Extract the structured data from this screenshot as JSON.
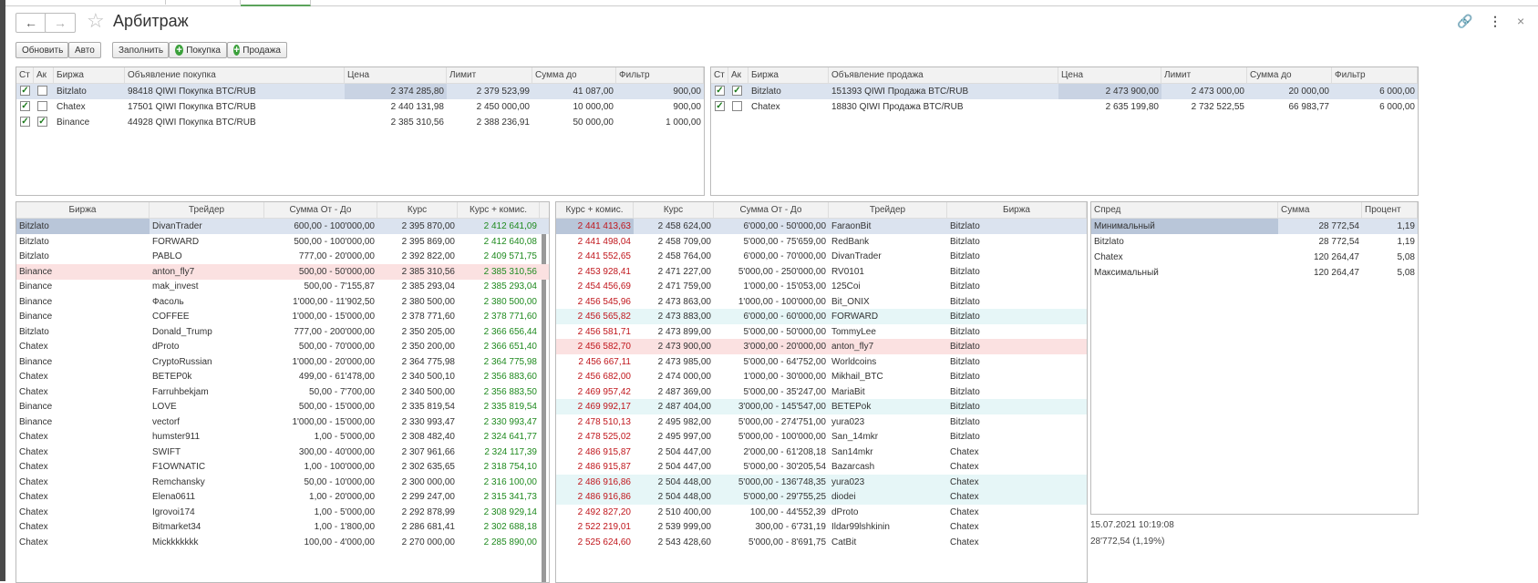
{
  "window": {
    "title": "Арбитраж"
  },
  "toolbar": {
    "refresh": "Обновить",
    "auto": "Авто",
    "fill": "Заполнить",
    "buy": "Покупка",
    "sell": "Продажа"
  },
  "buy_ads": {
    "columns": [
      "Ст",
      "Ак",
      "Биржа",
      "Объявление покупка",
      "Цена",
      "Лимит",
      "Сумма до",
      "Фильтр"
    ],
    "rows": [
      {
        "st": true,
        "ak": false,
        "exchange": "Bitzlato",
        "ad": "98418 QIWI Покупка BTC/RUB",
        "price": "2 374 285,80",
        "limit": "2 379 523,99",
        "sum_to": "41 087,00",
        "filter": "900,00"
      },
      {
        "st": true,
        "ak": false,
        "exchange": "Chatex",
        "ad": "17501 QIWI Покупка BTC/RUB",
        "price": "2 440 131,98",
        "limit": "2 450 000,00",
        "sum_to": "10 000,00",
        "filter": "900,00"
      },
      {
        "st": true,
        "ak": true,
        "exchange": "Binance",
        "ad": "44928 QIWI Покупка BTC/RUB",
        "price": "2 385 310,56",
        "limit": "2 388 236,91",
        "sum_to": "50 000,00",
        "filter": "1 000,00"
      }
    ]
  },
  "sell_ads": {
    "columns": [
      "Ст",
      "Ак",
      "Биржа",
      "Объявление продажа",
      "Цена",
      "Лимит",
      "Сумма до",
      "Фильтр"
    ],
    "rows": [
      {
        "st": true,
        "ak": true,
        "exchange": "Bitzlato",
        "ad": "151393 QIWI Продажа BTC/RUB",
        "price": "2 473 900,00",
        "limit": "2 473 000,00",
        "sum_to": "20 000,00",
        "filter": "6 000,00"
      },
      {
        "st": true,
        "ak": false,
        "exchange": "Chatex",
        "ad": "18830 QIWI Продажа BTC/RUB",
        "price": "2 635 199,80",
        "limit": "2 732 522,55",
        "sum_to": "66 983,77",
        "filter": "6 000,00"
      }
    ]
  },
  "buy_offers": {
    "columns": [
      "Биржа",
      "Трейдер",
      "Сумма От - До",
      "Курс",
      "Курс + комис."
    ],
    "rows": [
      [
        "Bitzlato",
        "DivanTrader",
        "600,00 - 100'000,00",
        "2 395 870,00",
        "2 412 641,09"
      ],
      [
        "Bitzlato",
        "FORWARD",
        "500,00 - 100'000,00",
        "2 395 869,00",
        "2 412 640,08"
      ],
      [
        "Bitzlato",
        "PABLO",
        "777,00 - 20'000,00",
        "2 392 822,00",
        "2 409 571,75"
      ],
      [
        "Binance",
        "anton_fly7",
        "500,00 - 50'000,00",
        "2 385 310,56",
        "2 385 310,56"
      ],
      [
        "Binance",
        "mak_invest",
        "500,00 - 7'155,87",
        "2 385 293,04",
        "2 385 293,04"
      ],
      [
        "Binance",
        "Фасоль",
        "1'000,00 - 11'902,50",
        "2 380 500,00",
        "2 380 500,00"
      ],
      [
        "Binance",
        "COFFEE",
        "1'000,00 - 15'000,00",
        "2 378 771,60",
        "2 378 771,60"
      ],
      [
        "Bitzlato",
        "Donald_Trump",
        "777,00 - 200'000,00",
        "2 350 205,00",
        "2 366 656,44"
      ],
      [
        "Chatex",
        "dProto",
        "500,00 - 70'000,00",
        "2 350 200,00",
        "2 366 651,40"
      ],
      [
        "Binance",
        "CryptoRussian",
        "1'000,00 - 20'000,00",
        "2 364 775,98",
        "2 364 775,98"
      ],
      [
        "Chatex",
        "ВЕТЕР0k",
        "499,00 - 61'478,00",
        "2 340 500,10",
        "2 356 883,60"
      ],
      [
        "Chatex",
        "Farruhbekjam",
        "50,00 - 7'700,00",
        "2 340 500,00",
        "2 356 883,50"
      ],
      [
        "Binance",
        "LOVE",
        "500,00 - 15'000,00",
        "2 335 819,54",
        "2 335 819,54"
      ],
      [
        "Binance",
        "vectorf",
        "1'000,00 - 15'000,00",
        "2 330 993,47",
        "2 330 993,47"
      ],
      [
        "Chatex",
        "humster911",
        "1,00 - 5'000,00",
        "2 308 482,40",
        "2 324 641,77"
      ],
      [
        "Chatex",
        "SWIFT",
        "300,00 - 40'000,00",
        "2 307 961,66",
        "2 324 117,39"
      ],
      [
        "Chatex",
        "F1OWNATIC",
        "1,00 - 100'000,00",
        "2 302 635,65",
        "2 318 754,10"
      ],
      [
        "Chatex",
        "Remchansky",
        "50,00 - 10'000,00",
        "2 300 000,00",
        "2 316 100,00"
      ],
      [
        "Chatex",
        "Elena0611",
        "1,00 - 20'000,00",
        "2 299 247,00",
        "2 315 341,73"
      ],
      [
        "Chatex",
        "Igrovoi174",
        "1,00 - 5'000,00",
        "2 292 878,99",
        "2 308 929,14"
      ],
      [
        "Chatex",
        "Bitmarket34",
        "1,00 - 1'800,00",
        "2 286 681,41",
        "2 302 688,18"
      ],
      [
        "Chatex",
        "Mickkkkkkk",
        "100,00 - 4'000,00",
        "2 270 000,00",
        "2 285 890,00"
      ]
    ]
  },
  "sell_offers": {
    "columns": [
      "Курс + комис.",
      "Курс",
      "Сумма От - До",
      "Трейдер",
      "Биржа"
    ],
    "rows": [
      [
        "2 441 413,63",
        "2 458 624,00",
        "6'000,00 - 50'000,00",
        "FaraonBit",
        "Bitzlato"
      ],
      [
        "2 441 498,04",
        "2 458 709,00",
        "5'000,00 - 75'659,00",
        "RedBank",
        "Bitzlato"
      ],
      [
        "2 441 552,65",
        "2 458 764,00",
        "6'000,00 - 70'000,00",
        "DivanTrader",
        "Bitzlato"
      ],
      [
        "2 453 928,41",
        "2 471 227,00",
        "5'000,00 - 250'000,00",
        "RV0101",
        "Bitzlato"
      ],
      [
        "2 454 456,69",
        "2 471 759,00",
        "1'000,00 - 15'053,00",
        "125Coi",
        "Bitzlato"
      ],
      [
        "2 456 545,96",
        "2 473 863,00",
        "1'000,00 - 100'000,00",
        "Bit_ONIX",
        "Bitzlato"
      ],
      [
        "2 456 565,82",
        "2 473 883,00",
        "6'000,00 - 60'000,00",
        "FORWARD",
        "Bitzlato"
      ],
      [
        "2 456 581,71",
        "2 473 899,00",
        "5'000,00 - 50'000,00",
        "TommyLee",
        "Bitzlato"
      ],
      [
        "2 456 582,70",
        "2 473 900,00",
        "3'000,00 - 20'000,00",
        "anton_fly7",
        "Bitzlato"
      ],
      [
        "2 456 667,11",
        "2 473 985,00",
        "5'000,00 - 64'752,00",
        "Worldcoins",
        "Bitzlato"
      ],
      [
        "2 456 682,00",
        "2 474 000,00",
        "1'000,00 - 30'000,00",
        "Mikhail_BTC",
        "Bitzlato"
      ],
      [
        "2 469 957,42",
        "2 487 369,00",
        "5'000,00 - 35'247,00",
        "MariaBit",
        "Bitzlato"
      ],
      [
        "2 469 992,17",
        "2 487 404,00",
        "3'000,00 - 145'547,00",
        "BETEPok",
        "Bitzlato"
      ],
      [
        "2 478 510,13",
        "2 495 982,00",
        "5'000,00 - 274'751,00",
        "yura023",
        "Bitzlato"
      ],
      [
        "2 478 525,02",
        "2 495 997,00",
        "5'000,00 - 100'000,00",
        "San_14mkr",
        "Bitzlato"
      ],
      [
        "2 486 915,87",
        "2 504 447,00",
        "2'000,00 - 61'208,18",
        "San14mkr",
        "Chatex"
      ],
      [
        "2 486 915,87",
        "2 504 447,00",
        "5'000,00 - 30'205,54",
        "Bazarcash",
        "Chatex"
      ],
      [
        "2 486 916,86",
        "2 504 448,00",
        "5'000,00 - 136'748,35",
        "yura023",
        "Chatex"
      ],
      [
        "2 486 916,86",
        "2 504 448,00",
        "5'000,00 - 29'755,25",
        "diodei",
        "Chatex"
      ],
      [
        "2 492 827,20",
        "2 510 400,00",
        "100,00 - 44'552,39",
        "dProto",
        "Chatex"
      ],
      [
        "2 522 219,01",
        "2 539 999,00",
        "300,00 - 6'731,19",
        "Ildar99lshkinin",
        "Chatex"
      ],
      [
        "2 525 624,60",
        "2 543 428,60",
        "5'000,00 - 8'691,75",
        "CatBit",
        "Chatex"
      ]
    ]
  },
  "spread": {
    "columns": [
      "Спред",
      "Сумма",
      "Процент"
    ],
    "rows": [
      [
        "Минимальный",
        "28 772,54",
        "1,19"
      ],
      [
        "Bitzlato",
        "28 772,54",
        "1,19"
      ],
      [
        "Chatex",
        "120 264,47",
        "5,08"
      ],
      [
        "Максимальный",
        "120 264,47",
        "5,08"
      ]
    ]
  },
  "status": {
    "timestamp": "15.07.2021 10:19:08",
    "summary": "28'772,54 (1,19%)"
  },
  "colors": {
    "accent_green": "#1f8a1f",
    "negative_red": "#c0161c",
    "selection": "#dbe3ef",
    "pink_row": "#fbe1e1",
    "cyan_row": "#e6f6f7"
  }
}
